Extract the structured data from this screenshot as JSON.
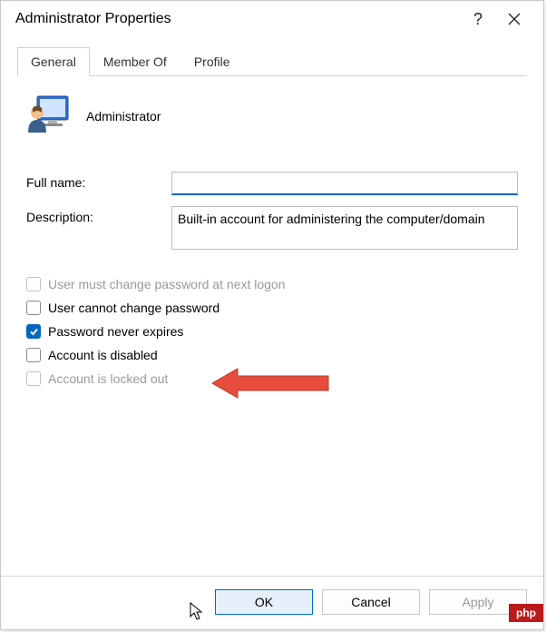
{
  "titlebar": {
    "title": "Administrator Properties"
  },
  "tabs": {
    "items": [
      {
        "label": "General"
      },
      {
        "label": "Member Of"
      },
      {
        "label": "Profile"
      }
    ]
  },
  "header": {
    "account_name": "Administrator"
  },
  "fields": {
    "full_name_label": "Full name:",
    "full_name_value": "",
    "description_label": "Description:",
    "description_value": "Built-in account for administering the computer/domain"
  },
  "checkboxes": {
    "must_change": "User must change password at next logon",
    "cannot_change": "User cannot change password",
    "never_expires": "Password never expires",
    "disabled": "Account is disabled",
    "locked_out": "Account is locked out"
  },
  "buttons": {
    "ok": "OK",
    "cancel": "Cancel",
    "apply": "Apply"
  },
  "watermark": "php"
}
